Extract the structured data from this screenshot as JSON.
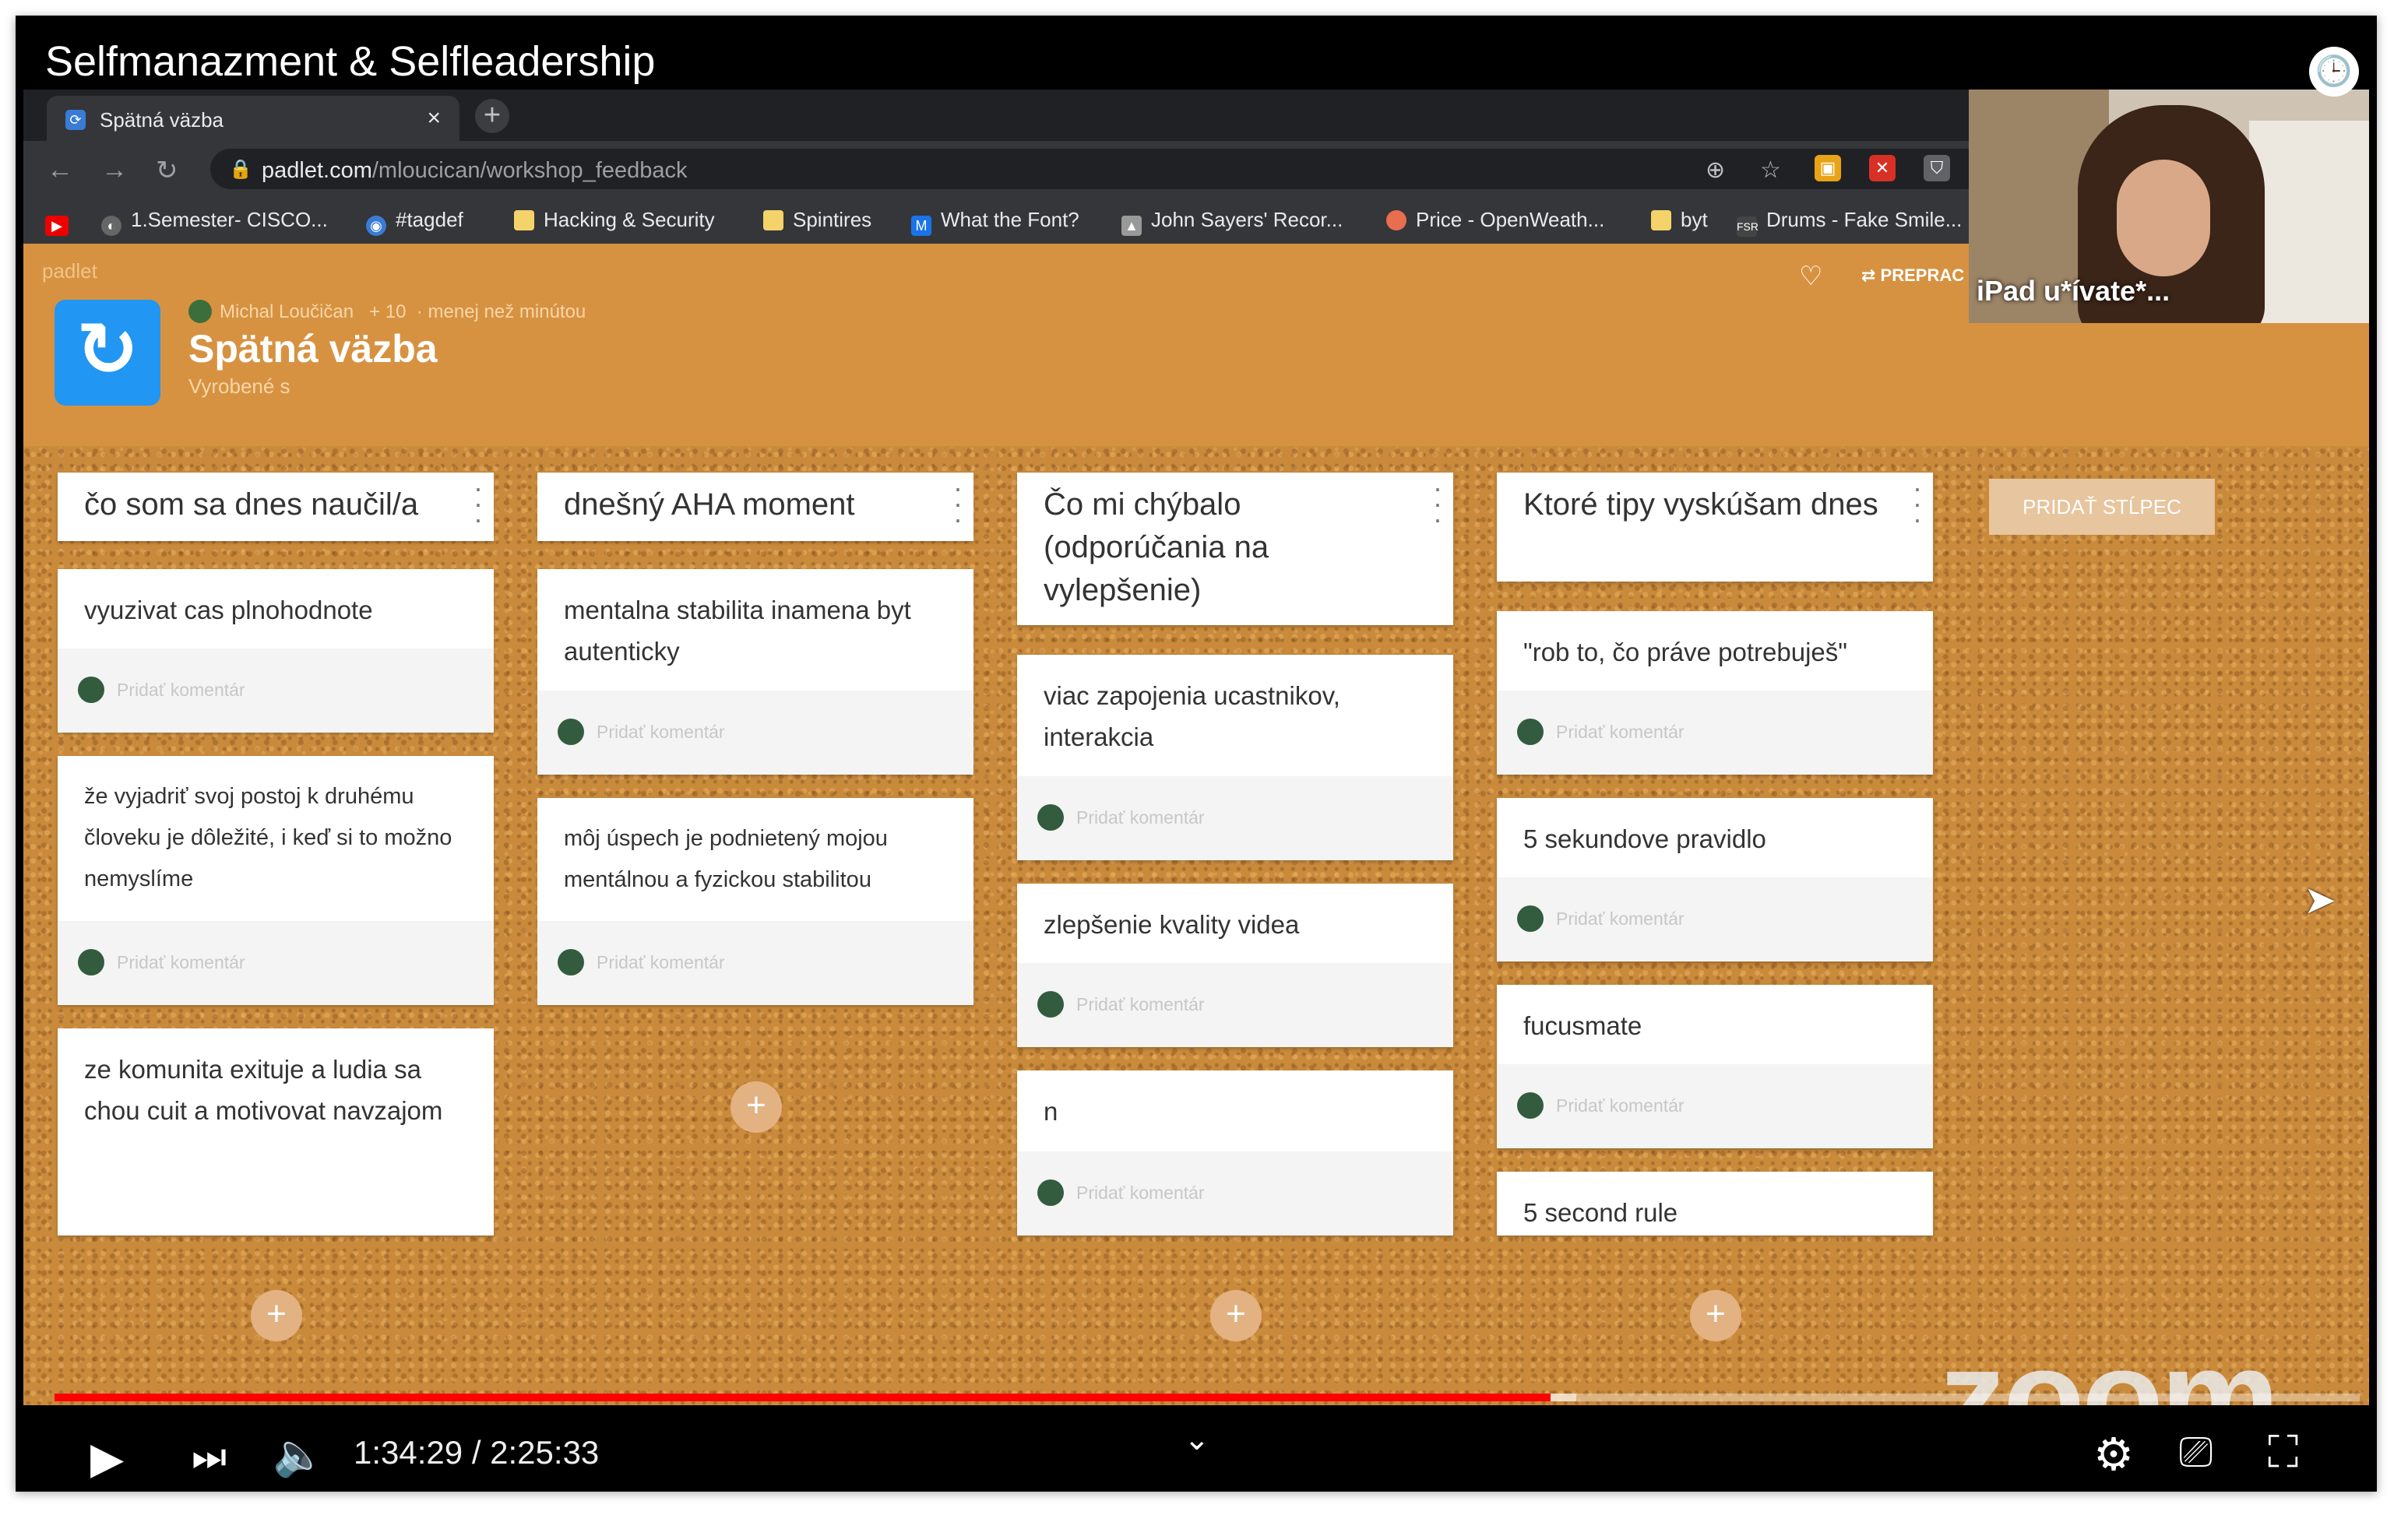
{
  "video_title": "Selfmanazment & Selfleadership",
  "browser": {
    "tab_title": "Spätná väzba",
    "url_domain": "padlet.com",
    "url_path": "/mloucican/workshop_feedback",
    "bookmarks": [
      "1.Semester- CISCO...",
      "#tagdef",
      "Hacking & Security",
      "Spintires",
      "What the Font?",
      "John Sayers' Recor...",
      "Price - OpenWeath...",
      "byt",
      "Drums - Fake Smile..."
    ]
  },
  "padlet": {
    "watermark": "padlet",
    "remake_label": "PREPRAC",
    "author": "Michal Loučičan",
    "contributors": "+ 10",
    "time": "menej než minútou",
    "title": "Spätná väzba",
    "subtitle": "Vyrobené s",
    "add_column": "PRIDAŤ STĹPEC",
    "comment_placeholder": "Pridať komentár",
    "columns": [
      {
        "title": "čo som sa dnes naučil/a",
        "cards": [
          "vyuzivat cas plnohodnote",
          "že vyjadriť svoj postoj k druhému človeku je dôležité, i keď si to možno nemyslíme",
          "ze komunita exituje a ludia sa chou cuit a motivovat navzajom"
        ]
      },
      {
        "title": "dnešný AHA moment",
        "cards": [
          "mentalna stabilita inamena byt autenticky",
          "môj úspech je podnietený mojou mentálnou a fyzickou stabilitou"
        ]
      },
      {
        "title": "Čo mi chýbalo (odporúčania na vylepšenie)",
        "cards": [
          "viac zapojenia ucastnikov, interakcia",
          "zlepšenie kvality videa",
          "n"
        ]
      },
      {
        "title": "Ktoré tipy vyskúšam dnes",
        "cards": [
          "\"rob to, čo práve potrebuješ\"",
          "5 sekundove pravidlo",
          "fucusmate",
          "5 second rule"
        ]
      }
    ]
  },
  "participant_name": "iPad u*ívate*...",
  "watermark_zoom": "zoom",
  "player": {
    "current_time": "1:34:29",
    "separator": "/",
    "duration": "2:25:33",
    "progress_fraction": 0.649,
    "buffered_fraction": 0.66
  },
  "colors": {
    "padlet_orange": "#d79241",
    "progress_red": "#ff0000",
    "padlet_logo": "#2196f3"
  }
}
